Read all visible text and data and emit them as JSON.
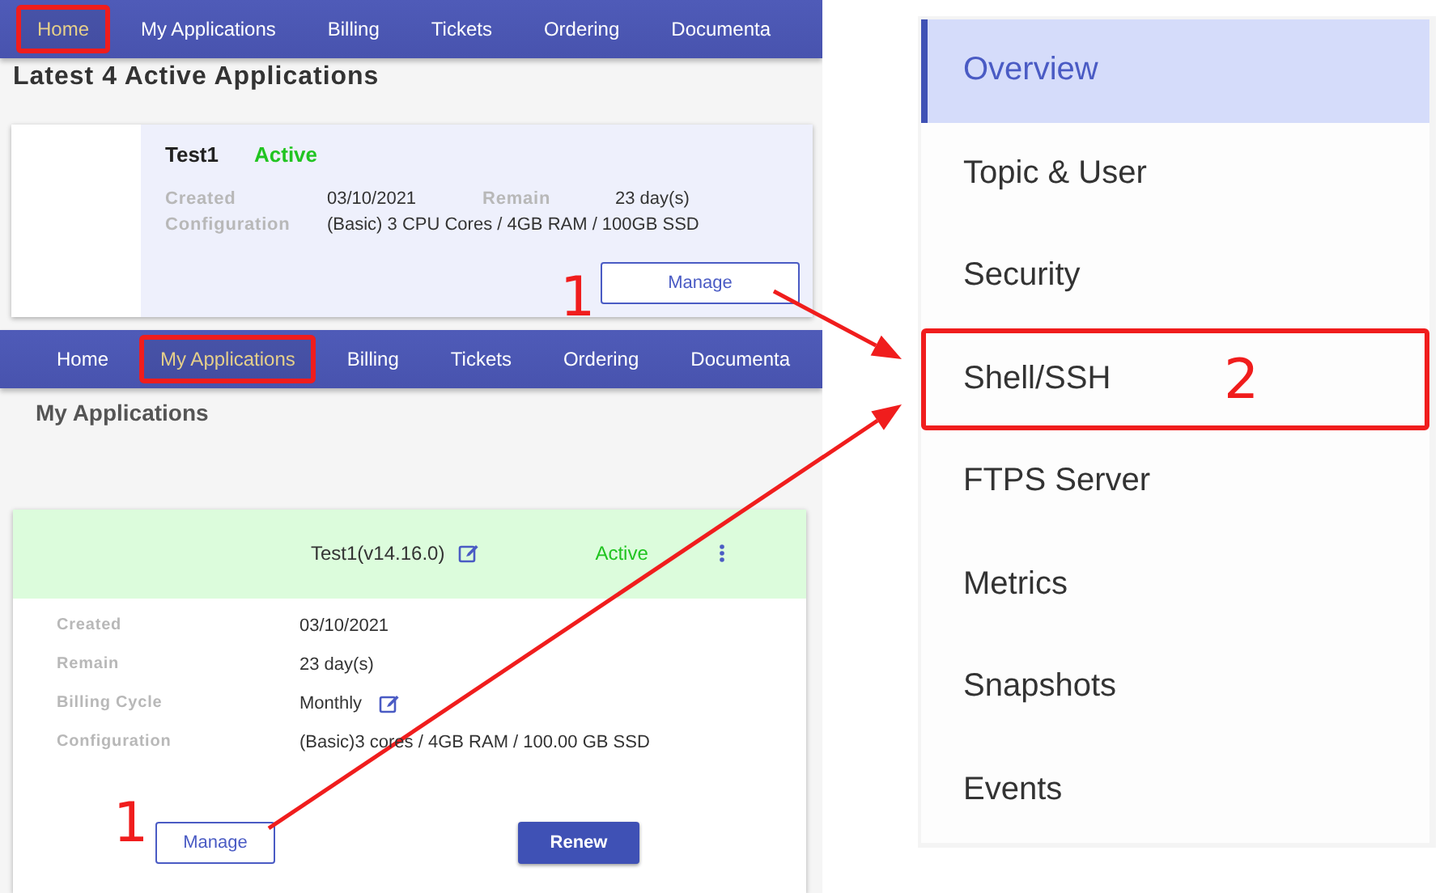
{
  "home_page": {
    "nav": [
      {
        "label": "Home",
        "selected": true,
        "highlighted": true
      },
      {
        "label": "My Applications",
        "selected": false,
        "highlighted": false
      },
      {
        "label": "Billing",
        "selected": false,
        "highlighted": false
      },
      {
        "label": "Tickets",
        "selected": false,
        "highlighted": false
      },
      {
        "label": "Ordering",
        "selected": false,
        "highlighted": false
      },
      {
        "label": "Documenta",
        "selected": false,
        "highlighted": false
      }
    ],
    "heading": "Latest 4 Active Applications",
    "card": {
      "name": "Test1",
      "status": "Active",
      "fields": [
        {
          "label": "Created",
          "value": "03/10/2021"
        },
        {
          "label": "Remain",
          "value": "23 day(s)"
        },
        {
          "label": "Configuration",
          "value": "(Basic) 3 CPU Cores / 4GB RAM / 100GB SSD"
        }
      ],
      "button": "Manage"
    }
  },
  "applications_page": {
    "nav": [
      {
        "label": "Home",
        "selected": false,
        "highlighted": false
      },
      {
        "label": "My Applications",
        "selected": true,
        "highlighted": true
      },
      {
        "label": "Billing",
        "selected": false,
        "highlighted": false
      },
      {
        "label": "Tickets",
        "selected": false,
        "highlighted": false
      },
      {
        "label": "Ordering",
        "selected": false,
        "highlighted": false
      },
      {
        "label": "Documenta",
        "selected": false,
        "highlighted": false
      }
    ],
    "heading": "My Applications",
    "card": {
      "title": "Test1(v14.16.0)",
      "status": "Active",
      "fields": [
        {
          "label": "Created",
          "value": "03/10/2021",
          "editable": false
        },
        {
          "label": "Remain",
          "value": "23 day(s)",
          "editable": false
        },
        {
          "label": "Billing Cycle",
          "value": "Monthly",
          "editable": true
        },
        {
          "label": "Configuration",
          "value": "(Basic)3 cores / 4GB RAM / 100.00 GB SSD",
          "editable": false
        }
      ],
      "buttons": [
        {
          "label": "Manage",
          "kind": "outlined"
        },
        {
          "label": "Renew",
          "kind": "filled"
        }
      ]
    }
  },
  "side_menu": {
    "items": [
      {
        "label": "Overview",
        "selected": true,
        "highlighted": false
      },
      {
        "label": "Topic & User",
        "selected": false,
        "highlighted": false
      },
      {
        "label": "Security",
        "selected": false,
        "highlighted": false
      },
      {
        "label": "Shell/SSH",
        "selected": false,
        "highlighted": true
      },
      {
        "label": "FTPS Server",
        "selected": false,
        "highlighted": false
      },
      {
        "label": "Metrics",
        "selected": false,
        "highlighted": false
      },
      {
        "label": "Snapshots",
        "selected": false,
        "highlighted": false
      },
      {
        "label": "Events",
        "selected": false,
        "highlighted": false
      }
    ]
  },
  "annotations": [
    {
      "number": "1"
    },
    {
      "number": "1"
    },
    {
      "number": "2"
    }
  ]
}
